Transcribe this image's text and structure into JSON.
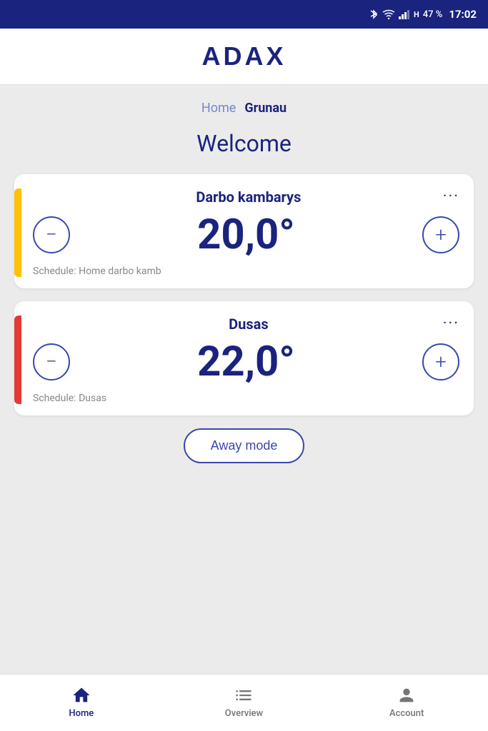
{
  "statusBar": {
    "battery": "47 %",
    "time": "17:02"
  },
  "header": {
    "logo": "ADAX"
  },
  "breadcrumb": {
    "homeLabel": "Home",
    "activeLabel": "Grunau"
  },
  "welcome": {
    "title": "Welcome"
  },
  "devices": [
    {
      "id": "darbo",
      "name": "Darbo kambarys",
      "temperature": "20,0°",
      "schedule": "Schedule: Home darbo kamb",
      "accentColor": "yellow"
    },
    {
      "id": "dusas",
      "name": "Dusas",
      "temperature": "22,0°",
      "schedule": "Schedule: Dusas",
      "accentColor": "orange-red"
    }
  ],
  "awayModeButton": "Away mode",
  "bottomNav": {
    "home": "Home",
    "overview": "Overview",
    "account": "Account"
  },
  "icons": {
    "bluetooth": "✦",
    "wifi": "▾",
    "signal": "▌",
    "battery": "🔋"
  }
}
